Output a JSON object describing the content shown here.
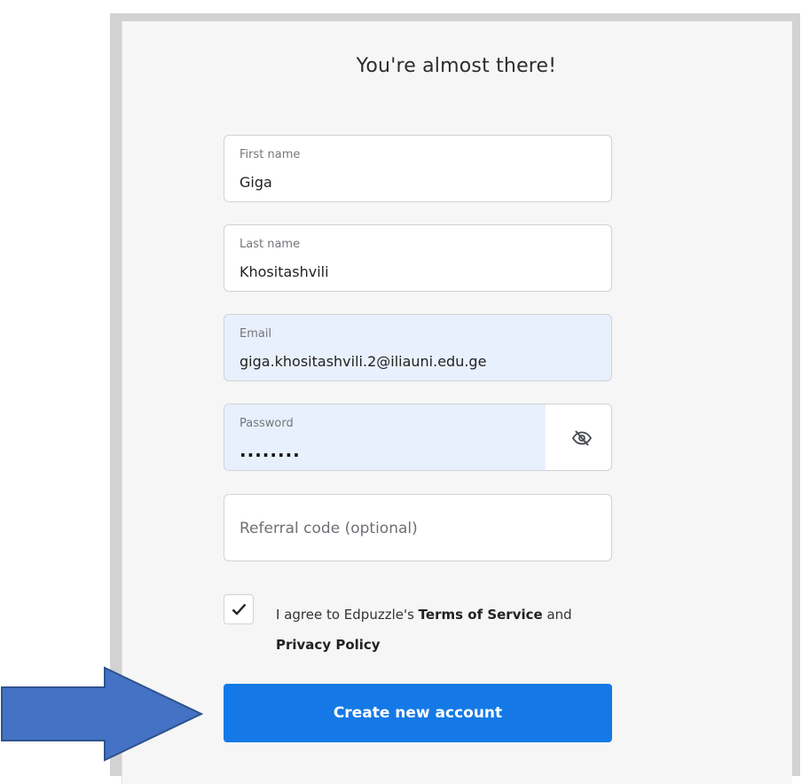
{
  "form": {
    "title": "You're almost there!",
    "first_name": {
      "label": "First name",
      "value": "Giga"
    },
    "last_name": {
      "label": "Last name",
      "value": "Khositashvili"
    },
    "email": {
      "label": "Email",
      "value": "giga.khositashvili.2@iliauni.edu.ge"
    },
    "password": {
      "label": "Password",
      "masked_value": "........",
      "toggle_icon": "eye-slash-icon"
    },
    "referral": {
      "placeholder": "Referral code (optional)"
    },
    "terms": {
      "checked": true,
      "prefix": "I agree to Edpuzzle's ",
      "terms_link": "Terms of Service",
      "middle": " and",
      "privacy_link": "Privacy Policy"
    },
    "submit_label": "Create new account"
  },
  "annotation": {
    "icon": "arrow-right-icon",
    "color": "#4472c4"
  },
  "colors": {
    "accent": "#1479e6",
    "autofill_bg": "#e8f0fd"
  }
}
